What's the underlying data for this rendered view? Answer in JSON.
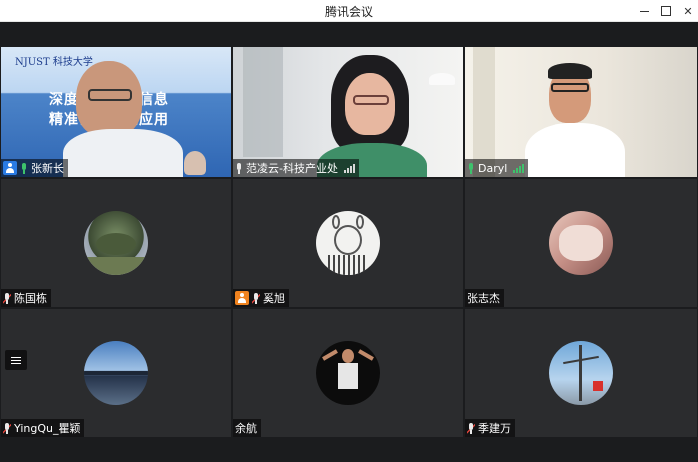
{
  "window": {
    "title": "腾讯会议"
  },
  "slide": {
    "header": "NJUST 科技大学",
    "line1": "深度学习空间信息",
    "line2": "精准识别研究应用"
  },
  "participants": [
    {
      "name": "张新长",
      "mic": "active",
      "badge": "host",
      "signal": false,
      "video": true
    },
    {
      "name": "范凌云-科技产业处",
      "mic": "on",
      "badge": "",
      "signal": true,
      "video": true
    },
    {
      "name": "Daryl",
      "mic": "active",
      "badge": "",
      "signal": true,
      "video": true
    },
    {
      "name": "陈国栋",
      "mic": "muted",
      "badge": "",
      "signal": false,
      "video": false
    },
    {
      "name": "奚旭",
      "mic": "muted",
      "badge": "orange",
      "signal": false,
      "video": false
    },
    {
      "name": "张志杰",
      "mic": "none",
      "badge": "",
      "signal": false,
      "video": false
    },
    {
      "name": "YingQu_瞿颖",
      "mic": "muted",
      "badge": "",
      "signal": false,
      "video": false
    },
    {
      "name": "余航",
      "mic": "none",
      "badge": "",
      "signal": false,
      "video": false
    },
    {
      "name": "季建万",
      "mic": "muted",
      "badge": "",
      "signal": false,
      "video": false
    }
  ],
  "colors": {
    "speaking_border": "#2fa85a",
    "tile_bg": "#2b2c2e",
    "stage_bg": "#1b1c1e",
    "host_badge": "#2a7be4",
    "cohost_badge": "#f0831f"
  }
}
